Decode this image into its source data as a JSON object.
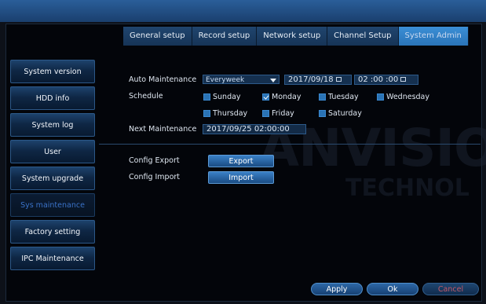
{
  "tabs": [
    {
      "label": "General setup",
      "active": false
    },
    {
      "label": "Record setup",
      "active": false
    },
    {
      "label": "Network setup",
      "active": false
    },
    {
      "label": "Channel Setup",
      "active": false
    },
    {
      "label": "System Admin",
      "active": true
    }
  ],
  "sidebar": {
    "items": [
      {
        "label": "System version",
        "active": false
      },
      {
        "label": "HDD info",
        "active": false
      },
      {
        "label": "System log",
        "active": false
      },
      {
        "label": "User",
        "active": false
      },
      {
        "label": "System upgrade",
        "active": false
      },
      {
        "label": "Sys maintenance",
        "active": true
      },
      {
        "label": "Factory setting",
        "active": false
      },
      {
        "label": "IPC Maintenance",
        "active": false
      }
    ]
  },
  "maintenance": {
    "auto_label": "Auto Maintenance",
    "auto_value": "Everyweek",
    "date": "2017/09/18",
    "time": "02 :00 :00",
    "schedule_label": "Schedule",
    "days": [
      {
        "label": "Sunday",
        "checked": false
      },
      {
        "label": "Monday",
        "checked": true
      },
      {
        "label": "Tuesday",
        "checked": false
      },
      {
        "label": "Wednesday",
        "checked": false
      },
      {
        "label": "Thursday",
        "checked": false
      },
      {
        "label": "Friday",
        "checked": false
      },
      {
        "label": "Saturday",
        "checked": false
      }
    ],
    "next_label": "Next Maintenance",
    "next_value": "2017/09/25 02:00:00"
  },
  "config": {
    "export_label": "Config Export",
    "export_button": "Export",
    "import_label": "Config Import",
    "import_button": "Import"
  },
  "footer": {
    "apply": "Apply",
    "ok": "Ok",
    "cancel": "Cancel"
  },
  "watermark": {
    "line1": "ANVISIO",
    "line2": "TECHNOL"
  },
  "colors": {
    "accent": "#2a74b8",
    "active_text": "#3a72c8"
  }
}
